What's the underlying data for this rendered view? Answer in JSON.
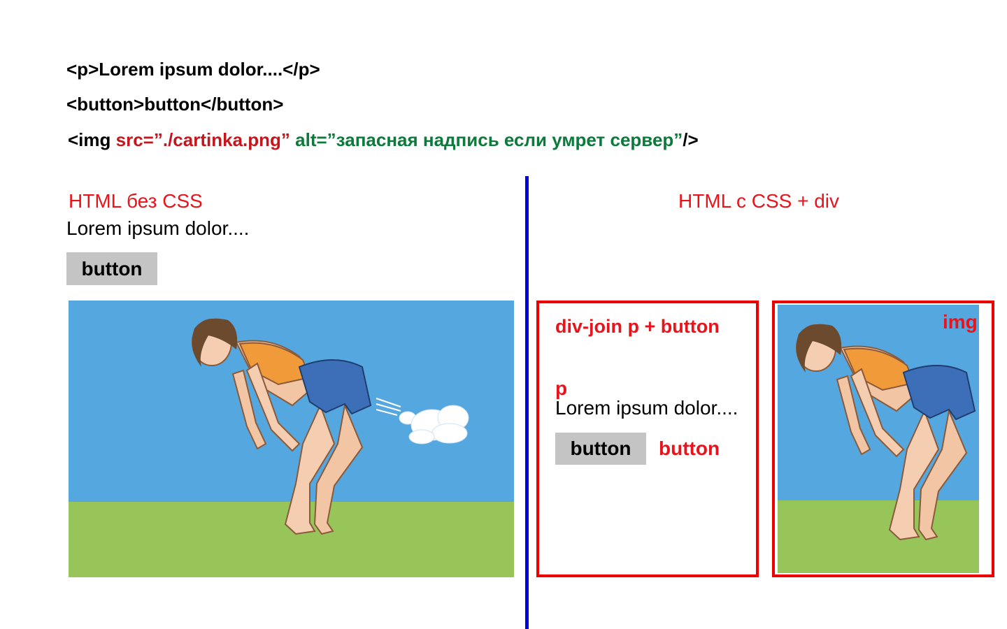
{
  "code": {
    "line1": "<p>Lorem ipsum dolor....</p>",
    "line2": "<button>button</button>",
    "line3": {
      "open": "<img ",
      "src": "src=”./cartinka.png”",
      "alt": " alt=”запасная надпись если умрет сервер”",
      "close": "/>"
    }
  },
  "left": {
    "title": "HTML без CSS",
    "paragraph": "Lorem ipsum dolor....",
    "button_label": "button"
  },
  "right": {
    "title": "HTML с CSS + div",
    "div_box": {
      "label": "div-join p + button",
      "p_label": "p",
      "paragraph": "Lorem ipsum dolor....",
      "button_label": "button",
      "button_annotation": "button"
    },
    "img_box": {
      "label": "img"
    }
  },
  "colors": {
    "title_red": "#e8141c",
    "box_red": "#ee0000",
    "divider_blue": "#0000e0",
    "attr_red": "#c4161c",
    "attr_green": "#0b7a3a",
    "button_grey": "#c4c4c4",
    "sky": "#55a7df",
    "grass": "#97c55a"
  }
}
